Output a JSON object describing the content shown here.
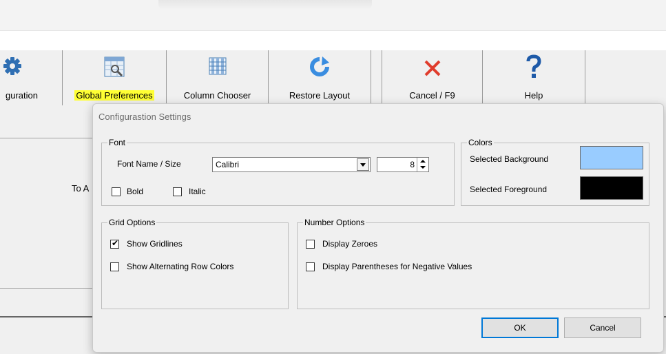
{
  "toolbar": {
    "buttons": [
      {
        "label": "guration",
        "icon": "gear-icon"
      },
      {
        "label": "Global Preferences",
        "icon": "table-wrench-icon"
      },
      {
        "label": "Column Chooser",
        "icon": "columns-icon"
      },
      {
        "label": "Restore Layout",
        "icon": "restore-arrow-icon"
      },
      {
        "label": "Cancel / F9",
        "icon": "red-x-icon"
      },
      {
        "label": "Help",
        "icon": "question-mark-icon"
      }
    ]
  },
  "background": {
    "partial_label": "To A"
  },
  "dialog": {
    "title": "Configurastion Settings",
    "font": {
      "legend": "Font",
      "name_size_label": "Font Name / Size",
      "font_name": "Calibri",
      "font_size": "8",
      "bold_label": "Bold",
      "bold_checked": false,
      "italic_label": "Italic",
      "italic_checked": false
    },
    "colors": {
      "legend": "Colors",
      "bg_label": "Selected Background",
      "bg_color": "#99ccff",
      "fg_label": "Selected Foreground",
      "fg_color": "#000000"
    },
    "grid": {
      "legend": "Grid Options",
      "show_gridlines": "Show Gridlines",
      "show_gridlines_checked": true,
      "alt_rows": "Show Alternating Row Colors",
      "alt_rows_checked": false
    },
    "number": {
      "legend": "Number Options",
      "zeroes": "Display Zeroes",
      "zeroes_checked": false,
      "parens": "Display Parentheses for Negative Values",
      "parens_checked": false
    },
    "ok_label": "OK",
    "cancel_label": "Cancel"
  },
  "colors": {
    "highlight": "#ffff33",
    "cancel_x": "#e03c2c",
    "help": "#1e5aa8",
    "restore": "#3a8de0"
  }
}
